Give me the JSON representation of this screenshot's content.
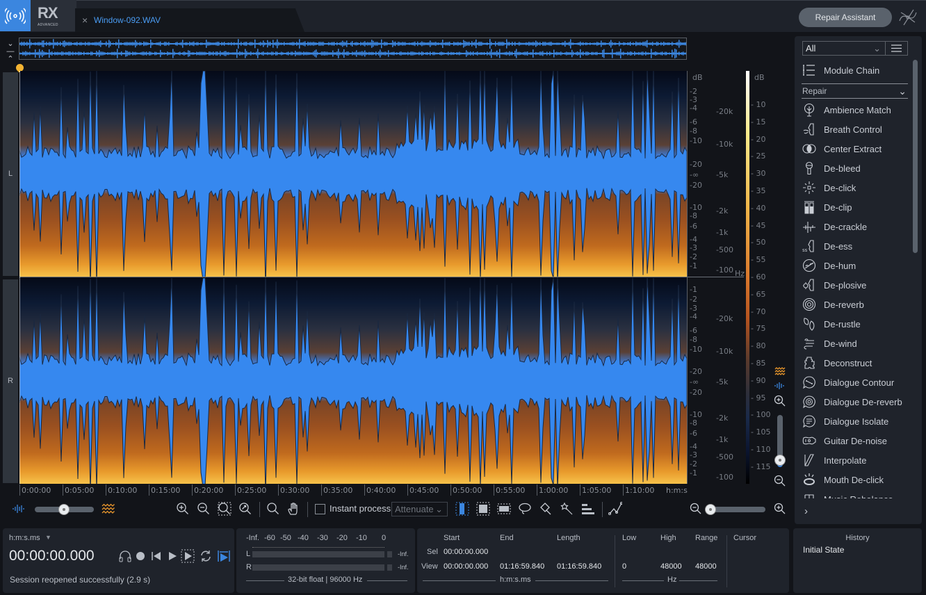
{
  "app": {
    "name": "RX",
    "edition": "ADVANCED"
  },
  "tab": {
    "file_name": "Window-092.WAV",
    "close_icon": "close-icon"
  },
  "header": {
    "repair_assistant": "Repair Assistant"
  },
  "channels": {
    "left": "L",
    "right": "R"
  },
  "amplitude_scale": {
    "unit": "dB",
    "left_ticks": [
      "-2",
      "-3",
      "-4",
      "-6",
      "-8",
      "-10",
      "-20",
      "-∞",
      "-20",
      "-10",
      "-8",
      "-6",
      "-4",
      "-3",
      "-2",
      "-1"
    ],
    "right_ticks": [
      "-1",
      "-2",
      "-3",
      "-4",
      "-6",
      "-8",
      "-10",
      "-20",
      "-∞",
      "-20",
      "-10",
      "-8",
      "-6",
      "-4",
      "-3",
      "-2",
      "-1"
    ]
  },
  "frequency_scale": {
    "unit": "Hz",
    "ticks": [
      "20k",
      "10k",
      "5k",
      "2k",
      "1k",
      "500",
      "100"
    ]
  },
  "colorbar": {
    "unit": "dB",
    "ticks": [
      "10",
      "15",
      "20",
      "25",
      "30",
      "35",
      "40",
      "45",
      "50",
      "55",
      "60",
      "65",
      "70",
      "75",
      "80",
      "85",
      "90",
      "95",
      "100",
      "105",
      "110",
      "115"
    ]
  },
  "time_ruler": {
    "unit": "h:m:s",
    "ticks": [
      "0:00:00",
      "0:05:00",
      "0:10:00",
      "0:15:00",
      "0:20:00",
      "0:25:00",
      "0:30:00",
      "0:35:00",
      "0:40:00",
      "0:45:00",
      "0:50:00",
      "0:55:00",
      "1:00:00",
      "1:05:00",
      "1:10:00"
    ]
  },
  "toolbar": {
    "instant_process": "Instant process",
    "instant_process_checked": false,
    "mode": "Attenuate",
    "waveform_spectrogram_blend": 0.5,
    "horizontal_zoom": 0.0,
    "vertical_zoom": 0.1
  },
  "module_panel": {
    "filter": "All",
    "module_chain": "Module Chain",
    "category": "Repair",
    "modules": [
      {
        "label": "Ambience Match",
        "icon": "ambience-match-icon"
      },
      {
        "label": "Breath Control",
        "icon": "breath-control-icon"
      },
      {
        "label": "Center Extract",
        "icon": "center-extract-icon"
      },
      {
        "label": "De-bleed",
        "icon": "microphone-icon"
      },
      {
        "label": "De-click",
        "icon": "de-click-icon"
      },
      {
        "label": "De-clip",
        "icon": "de-clip-icon"
      },
      {
        "label": "De-crackle",
        "icon": "de-crackle-icon"
      },
      {
        "label": "De-ess",
        "icon": "de-ess-icon"
      },
      {
        "label": "De-hum",
        "icon": "de-hum-icon"
      },
      {
        "label": "De-plosive",
        "icon": "de-plosive-icon"
      },
      {
        "label": "De-reverb",
        "icon": "de-reverb-icon"
      },
      {
        "label": "De-rustle",
        "icon": "leaf-icon"
      },
      {
        "label": "De-wind",
        "icon": "wind-icon"
      },
      {
        "label": "Deconstruct",
        "icon": "puzzle-icon"
      },
      {
        "label": "Dialogue Contour",
        "icon": "dialogue-contour-icon"
      },
      {
        "label": "Dialogue De-reverb",
        "icon": "dialogue-de-reverb-icon"
      },
      {
        "label": "Dialogue Isolate",
        "icon": "dialogue-isolate-icon"
      },
      {
        "label": "Guitar De-noise",
        "icon": "guitar-icon"
      },
      {
        "label": "Interpolate",
        "icon": "interpolate-icon"
      },
      {
        "label": "Mouth De-click",
        "icon": "mouth-icon"
      },
      {
        "label": "Music Rebalance",
        "icon": "music-rebalance-icon"
      }
    ]
  },
  "transport": {
    "time_format": "h:m:s.ms",
    "time": "00:00:00.000",
    "status": "Session reopened successfully (2.9 s)"
  },
  "meters": {
    "scale": [
      "-Inf.",
      "-60",
      "-50",
      "-40",
      "-30",
      "-20",
      "-10",
      "0"
    ],
    "left_label": "L",
    "right_label": "R",
    "left_peak": "-Inf.",
    "right_peak": "-Inf.",
    "format": "32-bit float | 96000 Hz"
  },
  "selection": {
    "headers": [
      "Start",
      "End",
      "Length"
    ],
    "sel_label": "Sel",
    "view_label": "View",
    "sel_start": "00:00:00.000",
    "view_start": "00:00:00.000",
    "view_end": "01:16:59.840",
    "view_length": "01:16:59.840",
    "unit": "h:m:s.ms"
  },
  "frequency": {
    "headers": [
      "Low",
      "High",
      "Range"
    ],
    "low": "0",
    "high": "48000",
    "range": "48000",
    "unit": "Hz",
    "cursor_label": "Cursor"
  },
  "history": {
    "title": "History",
    "items": [
      "Initial State"
    ]
  },
  "colors": {
    "accent": "#3b86df",
    "waveform": "#3b82e8",
    "playhead": "#f3b332",
    "spectrogram_hot": "#f7c24a"
  }
}
